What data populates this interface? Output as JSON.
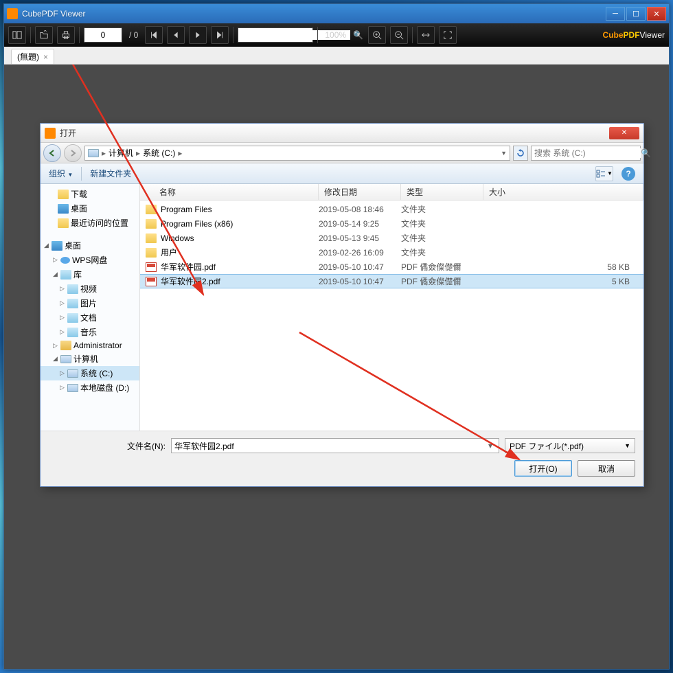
{
  "app": {
    "title": "CubePDF Viewer",
    "brand1": "Cube",
    "brand2": "PDF",
    "brand3": "Viewer"
  },
  "toolbar": {
    "page_value": "0",
    "page_total": "/ 0",
    "zoom": "100%"
  },
  "tab": {
    "label": "(無題)"
  },
  "dialog": {
    "title": "打开",
    "breadcrumb": {
      "computer": "计算机",
      "drive": "系统 (C:)"
    },
    "search_placeholder": "搜索 系统 (C:)",
    "organize": "组织",
    "new_folder": "新建文件夹",
    "columns": {
      "name": "名称",
      "date": "修改日期",
      "type": "类型",
      "size": "大小"
    },
    "tree": {
      "downloads": "下载",
      "desktop": "桌面",
      "recent": "最近访问的位置",
      "desktop2": "桌面",
      "wps": "WPS网盘",
      "library": "库",
      "video": "视频",
      "pictures": "图片",
      "documents": "文档",
      "music": "音乐",
      "admin": "Administrator",
      "computer": "计算机",
      "drive_c": "系统 (C:)",
      "drive_d": "本地磁盘 (D:)"
    },
    "files": [
      {
        "name": "Program Files",
        "date": "2019-05-08 18:46",
        "type": "文件夹",
        "size": "",
        "icon": "folder"
      },
      {
        "name": "Program Files (x86)",
        "date": "2019-05-14 9:25",
        "type": "文件夹",
        "size": "",
        "icon": "folder"
      },
      {
        "name": "Windows",
        "date": "2019-05-13 9:45",
        "type": "文件夹",
        "size": "",
        "icon": "folder"
      },
      {
        "name": "用户",
        "date": "2019-02-26 16:09",
        "type": "文件夹",
        "size": "",
        "icon": "folder"
      },
      {
        "name": "华军软件园.pdf",
        "date": "2019-05-10 10:47",
        "type": "PDF 僪僉儏儊儞",
        "size": "58 KB",
        "icon": "pdf"
      },
      {
        "name": "华军软件园2.pdf",
        "date": "2019-05-10 10:47",
        "type": "PDF 僪僉儏儊儞",
        "size": "5 KB",
        "icon": "pdf",
        "selected": true
      }
    ],
    "filename_label": "文件名(N):",
    "filename_value": "华军软件园2.pdf",
    "filter": "PDF ファイル(*.pdf)",
    "open_btn": "打开(O)",
    "cancel_btn": "取消"
  }
}
